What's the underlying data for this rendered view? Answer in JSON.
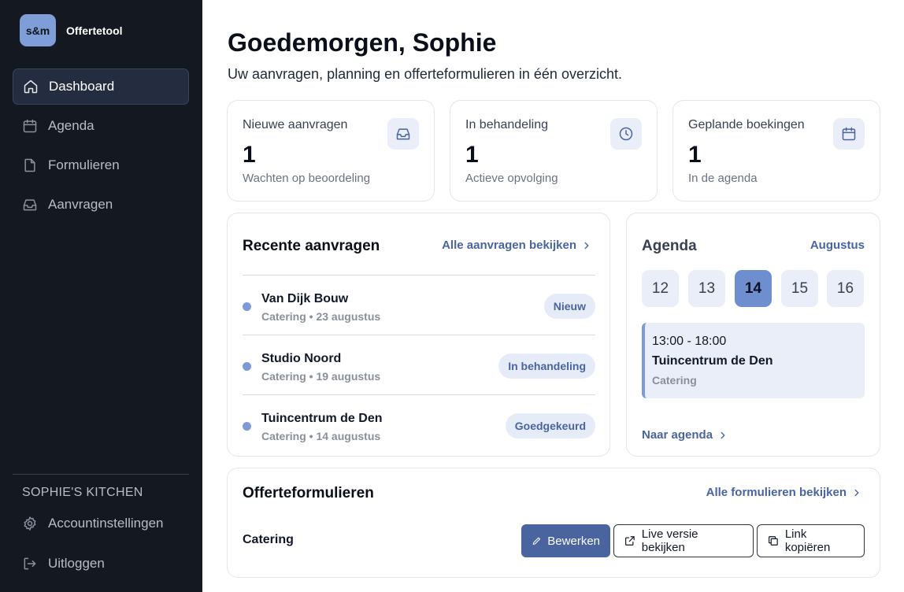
{
  "app": {
    "logo_text": "s&m",
    "name": "Offertetool"
  },
  "sidebar": {
    "items": [
      {
        "label": "Dashboard",
        "icon": "home-icon",
        "active": true
      },
      {
        "label": "Agenda",
        "icon": "calendar-icon"
      },
      {
        "label": "Formulieren",
        "icon": "document-icon"
      },
      {
        "label": "Aanvragen",
        "icon": "inbox-icon"
      }
    ],
    "org_name": "SOPHIE'S KITCHEN",
    "settings_label": "Accountinstellingen",
    "logout_label": "Uitloggen"
  },
  "header": {
    "greeting": "Goedemorgen, Sophie",
    "subtitle": "Uw aanvragen, planning en offerteformulieren in één overzicht."
  },
  "stats": [
    {
      "label": "Nieuwe aanvragen",
      "value": "1",
      "sub": "Wachten op beoordeling",
      "icon": "inbox-icon"
    },
    {
      "label": "In behandeling",
      "value": "1",
      "sub": "Actieve opvolging",
      "icon": "clock-icon"
    },
    {
      "label": "Geplande boekingen",
      "value": "1",
      "sub": "In de agenda",
      "icon": "calendar-icon"
    }
  ],
  "recent": {
    "title": "Recente aanvragen",
    "link_label": "Alle aanvragen bekijken",
    "items": [
      {
        "name": "Van Dijk Bouw",
        "meta": "Catering • 23 augustus",
        "status": "Nieuw"
      },
      {
        "name": "Studio Noord",
        "meta": "Catering • 19 augustus",
        "status": "In behandeling"
      },
      {
        "name": "Tuincentrum de Den",
        "meta": "Catering • 14 augustus",
        "status": "Goedgekeurd"
      }
    ]
  },
  "agenda": {
    "title": "Agenda",
    "month": "Augustus",
    "days": [
      "12",
      "13",
      "14",
      "15",
      "16"
    ],
    "selected_day": "14",
    "event": {
      "time": "13:00 - 18:00",
      "title": "Tuincentrum de Den",
      "category": "Catering"
    },
    "link_label": "Naar agenda"
  },
  "forms": {
    "title": "Offerteformulieren",
    "link_label": "Alle formulieren bekijken",
    "items": [
      {
        "name": "Catering",
        "edit_label": "Bewerken",
        "live_label": "Live versie bekijken",
        "copy_label": "Link kopiëren"
      }
    ]
  },
  "colors": {
    "sidebar_bg": "#141821",
    "accent": "#4a64a0",
    "accent_light": "#e9eef8",
    "dot": "#7e9ad6"
  }
}
